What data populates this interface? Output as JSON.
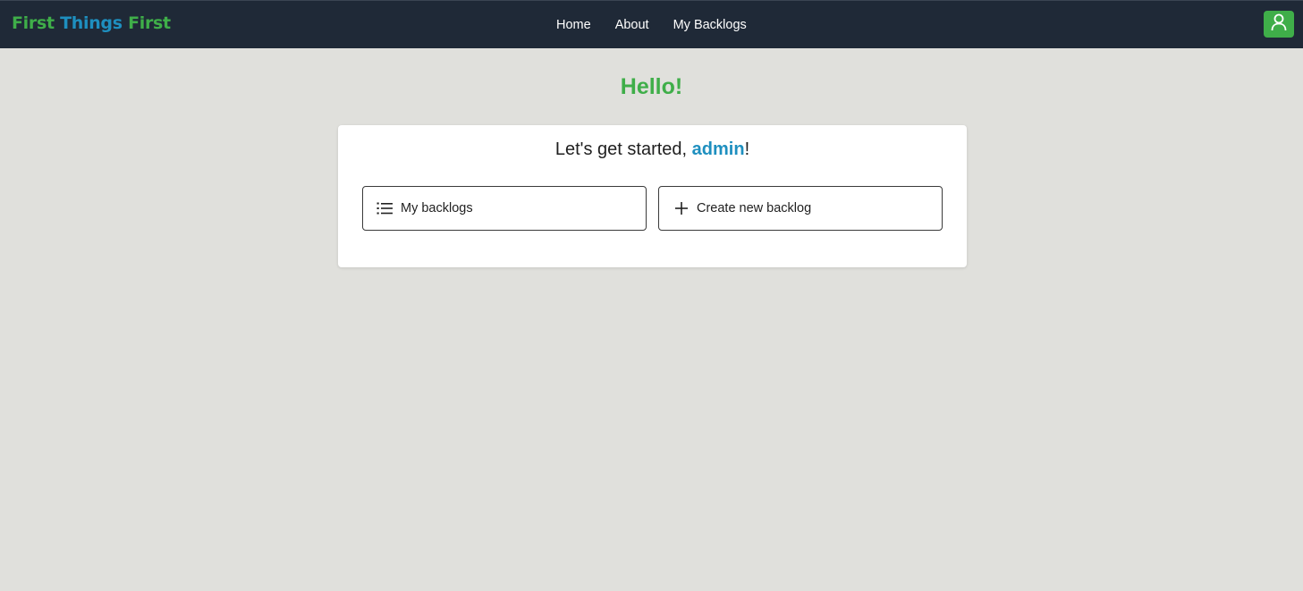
{
  "navbar": {
    "brand": {
      "word1": "First",
      "word2": "Things",
      "word3": "First"
    },
    "links": [
      {
        "label": "Home"
      },
      {
        "label": "About"
      },
      {
        "label": "My Backlogs"
      }
    ],
    "user_icon": "user-icon"
  },
  "main": {
    "greeting": "Hello!",
    "card": {
      "title_prefix": "Let's get started, ",
      "username": "admin",
      "title_suffix": "!",
      "buttons": [
        {
          "label": "My backlogs",
          "icon": "list-icon"
        },
        {
          "label": "Create new backlog",
          "icon": "plus-icon"
        }
      ]
    }
  },
  "colors": {
    "navbar_bg": "#1f2937",
    "brand_green": "#3fae49",
    "brand_blue": "#1e8fbf",
    "page_bg": "#e0e0dc"
  }
}
